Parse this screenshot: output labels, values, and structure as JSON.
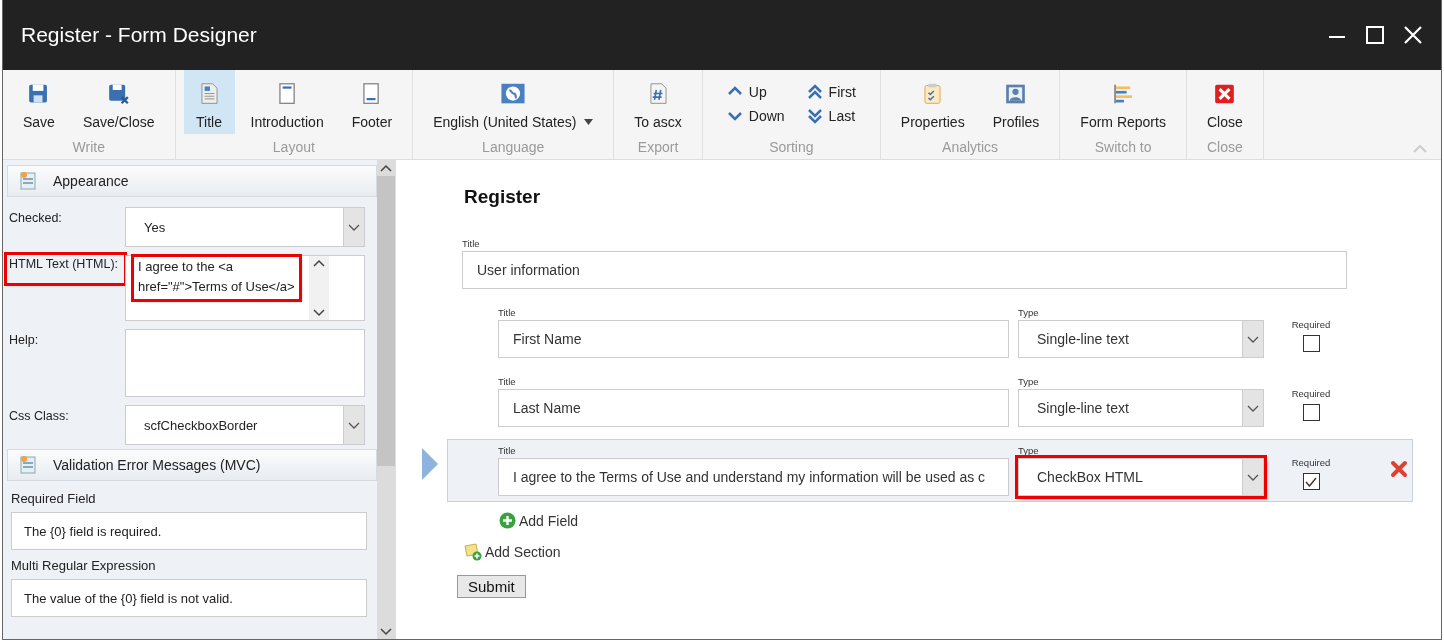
{
  "window": {
    "title": "Register - Form Designer"
  },
  "ribbon": {
    "groups": [
      {
        "label": "Write",
        "items": [
          {
            "kind": "large",
            "label": "Save",
            "selected": false
          },
          {
            "kind": "large",
            "label": "Save/Close",
            "selected": false
          }
        ]
      },
      {
        "label": "Layout",
        "items": [
          {
            "kind": "large",
            "label": "Title",
            "selected": true
          },
          {
            "kind": "large",
            "label": "Introduction",
            "selected": false
          },
          {
            "kind": "large",
            "label": "Footer",
            "selected": false
          }
        ]
      },
      {
        "label": "Language",
        "items": [
          {
            "kind": "dropdown",
            "label": "English (United States)",
            "selected": false
          }
        ]
      },
      {
        "label": "Export",
        "items": [
          {
            "kind": "large",
            "label": "To ascx",
            "selected": false
          }
        ]
      },
      {
        "label": "Sorting",
        "items": [
          {
            "kind": "small",
            "label": "Up",
            "selected": false
          },
          {
            "kind": "small",
            "label": "Down",
            "selected": false
          },
          {
            "kind": "small",
            "label": "First",
            "selected": false
          },
          {
            "kind": "small",
            "label": "Last",
            "selected": false
          }
        ]
      },
      {
        "label": "Analytics",
        "items": [
          {
            "kind": "large",
            "label": "Properties",
            "selected": false
          },
          {
            "kind": "large",
            "label": "Profiles",
            "selected": false
          }
        ]
      },
      {
        "label": "Switch to",
        "items": [
          {
            "kind": "large",
            "label": "Form Reports",
            "selected": false
          }
        ]
      },
      {
        "label": "Close",
        "items": [
          {
            "kind": "large",
            "label": "Close",
            "selected": false
          }
        ]
      }
    ]
  },
  "properties": {
    "sections": [
      {
        "title": "Appearance",
        "rows": [
          {
            "kind": "select",
            "label": "Checked:",
            "value": "Yes",
            "highlighted": false
          },
          {
            "kind": "textarea",
            "label": "HTML Text (HTML):",
            "lines": [
              "I agree to the <a",
              "href=\"#\">Terms of Use</a>"
            ],
            "highlighted": true
          },
          {
            "kind": "textarea",
            "label": "Help:",
            "highlighted": false
          },
          {
            "kind": "select",
            "label": "Css Class:",
            "value": "scfCheckboxBorder",
            "highlighted": false
          }
        ]
      },
      {
        "title": "Validation Error Messages (MVC)",
        "rows": [
          {
            "kind": "stacked",
            "label": "Required Field",
            "value": "The {0} field is required.",
            "highlighted": false
          },
          {
            "kind": "stacked",
            "label": "Multi Regular Expression",
            "value": "The value of the {0} field is not valid.",
            "highlighted": false
          }
        ]
      }
    ]
  },
  "form": {
    "title": "Register",
    "section": {
      "title_label": "Title",
      "value": "User information"
    },
    "fields": [
      {
        "title_label": "Title",
        "title": "First Name",
        "type_label": "Type",
        "type": "Single-line text",
        "required_label": "Required",
        "required": false,
        "selected": false,
        "type_highlighted": false
      },
      {
        "title_label": "Title",
        "title": "Last Name",
        "type_label": "Type",
        "type": "Single-line text",
        "required_label": "Required",
        "required": false,
        "selected": false,
        "type_highlighted": false
      },
      {
        "title_label": "Title",
        "title": "I agree to the Terms of Use and understand my information will be used as c",
        "type_label": "Type",
        "type": "CheckBox HTML",
        "required_label": "Required",
        "required": true,
        "selected": true,
        "type_highlighted": true
      }
    ],
    "add_field": "Add Field",
    "add_section": "Add Section",
    "submit": "Submit"
  }
}
